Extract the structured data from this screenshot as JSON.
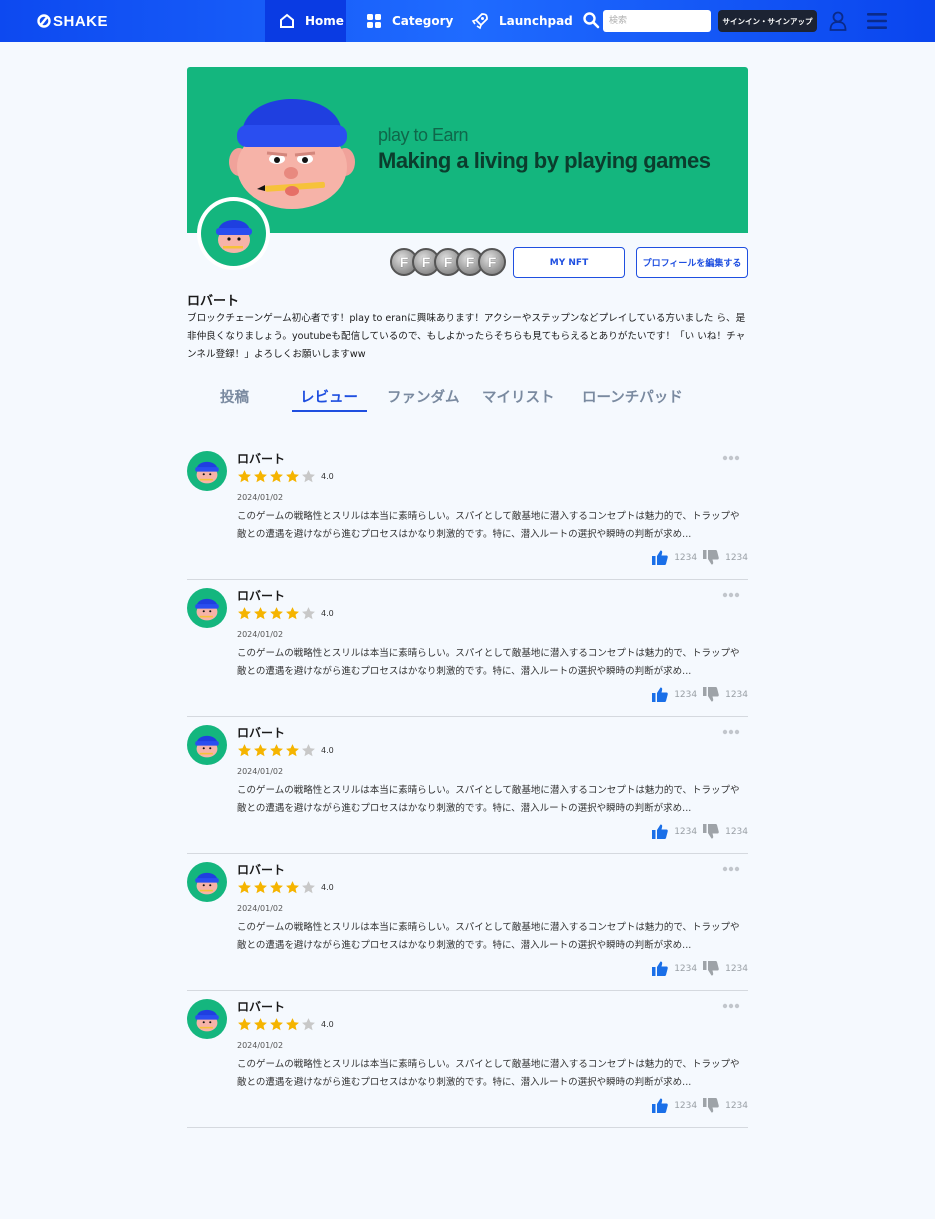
{
  "header": {
    "logo_text": "SHAKE",
    "nav": [
      {
        "label": "Home",
        "icon": "home-icon",
        "active": true
      },
      {
        "label": "Category",
        "icon": "category-icon",
        "active": false
      },
      {
        "label": "Launchpad",
        "icon": "rocket-icon",
        "active": false
      }
    ],
    "search_placeholder": "検索",
    "signin_label": "サインイン・サインアップ"
  },
  "banner": {
    "subtitle": "play to Earn",
    "title": "Making a living by playing games"
  },
  "profile": {
    "badges": [
      "F",
      "F",
      "F",
      "F",
      "F"
    ],
    "my_nft_label": "MY NFT",
    "edit_profile_label": "プロフィールを編集する",
    "name": "ロバート",
    "bio": "ブロックチェーンゲーム初心者です！play to eranに興味あります！アクシーやステップンなどプレイしている方いました ら、是非仲良くなりましょう。youtubeも配信しているので、もしよかったらそちらも見てもらえるとありがたいです！「い いね！チャンネル登録！」よろしくお願いしますww"
  },
  "tabs": [
    "投稿",
    "レビュー",
    "ファンダム",
    "マイリスト",
    "ローンチパッド"
  ],
  "active_tab": "レビュー",
  "reviews": [
    {
      "name": "ロバート",
      "rating": 4,
      "score": "4.0",
      "date": "2024/01/02",
      "text": "このゲームの戦略性とスリルは本当に素晴らしい。スパイとして敵基地に潜入するコンセプトは魅力的で、トラップや敵との遭遇を避けながら進むプロセスはかなり刺激的です。特に、潜入ルートの選択や瞬時の判断が求め...",
      "likes": "1234",
      "dislikes": "1234"
    },
    {
      "name": "ロバート",
      "rating": 4,
      "score": "4.0",
      "date": "2024/01/02",
      "text": "このゲームの戦略性とスリルは本当に素晴らしい。スパイとして敵基地に潜入するコンセプトは魅力的で、トラップや敵との遭遇を避けながら進むプロセスはかなり刺激的です。特に、潜入ルートの選択や瞬時の判断が求め...",
      "likes": "1234",
      "dislikes": "1234"
    },
    {
      "name": "ロバート",
      "rating": 4,
      "score": "4.0",
      "date": "2024/01/02",
      "text": "このゲームの戦略性とスリルは本当に素晴らしい。スパイとして敵基地に潜入するコンセプトは魅力的で、トラップや敵との遭遇を避けながら進むプロセスはかなり刺激的です。特に、潜入ルートの選択や瞬時の判断が求め...",
      "likes": "1234",
      "dislikes": "1234"
    },
    {
      "name": "ロバート",
      "rating": 4,
      "score": "4.0",
      "date": "2024/01/02",
      "text": "このゲームの戦略性とスリルは本当に素晴らしい。スパイとして敵基地に潜入するコンセプトは魅力的で、トラップや敵との遭遇を避けながら進むプロセスはかなり刺激的です。特に、潜入ルートの選択や瞬時の判断が求め...",
      "likes": "1234",
      "dislikes": "1234"
    },
    {
      "name": "ロバート",
      "rating": 4,
      "score": "4.0",
      "date": "2024/01/02",
      "text": "このゲームの戦略性とスリルは本当に素晴らしい。スパイとして敵基地に潜入するコンセプトは魅力的で、トラップや敵との遭遇を避けながら進むプロセスはかなり刺激的です。特に、潜入ルートの選択や瞬時の判断が求め...",
      "likes": "1234",
      "dislikes": "1234"
    }
  ],
  "colors": {
    "brand_blue": "#1f4fe0",
    "banner_green": "#14b67e",
    "star_yellow": "#f5b400",
    "like_blue": "#1a6fe8"
  }
}
